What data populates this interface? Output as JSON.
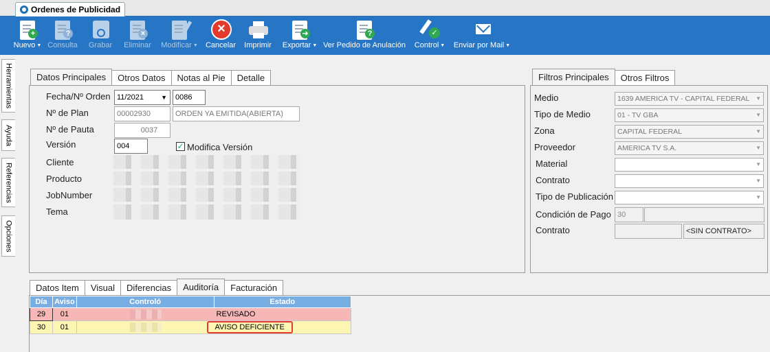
{
  "window": {
    "tab_title": "Ordenes de Publicidad"
  },
  "toolbar": {
    "buttons": [
      {
        "label": "Nuevo",
        "icon": "new-document-icon",
        "enabled": true,
        "dropdown": true
      },
      {
        "label": "Consulta",
        "icon": "query-document-icon",
        "enabled": false,
        "dropdown": false
      },
      {
        "label": "Grabar",
        "icon": "save-disk-icon",
        "enabled": false,
        "dropdown": false
      },
      {
        "label": "Eliminar",
        "icon": "delete-document-icon",
        "enabled": false,
        "dropdown": false
      },
      {
        "label": "Modificar",
        "icon": "edit-document-icon",
        "enabled": false,
        "dropdown": true
      },
      {
        "label": "Cancelar",
        "icon": "cancel-icon",
        "enabled": true,
        "dropdown": false
      },
      {
        "label": "Imprimir",
        "icon": "printer-icon",
        "enabled": true,
        "dropdown": false
      },
      {
        "label": "Exportar",
        "icon": "export-document-icon",
        "enabled": true,
        "dropdown": true
      },
      {
        "label": "Ver Pedido de Anulación",
        "icon": "cancel-request-icon",
        "enabled": true,
        "dropdown": false
      },
      {
        "label": "Control",
        "icon": "approve-pen-icon",
        "enabled": true,
        "dropdown": true
      },
      {
        "label": "Enviar por Mail",
        "icon": "email-icon",
        "enabled": true,
        "dropdown": true
      }
    ]
  },
  "sidebar": {
    "tabs": [
      "Herramientas",
      "Ayuda",
      "Referencias",
      "Opciones"
    ]
  },
  "main_tabs": {
    "items": [
      "Datos Principales",
      "Otros Datos",
      "Notas al Pie",
      "Detalle"
    ],
    "active": "Datos Principales"
  },
  "datos": {
    "fecha_label": "Fecha/Nº Orden",
    "fecha_value": "11/2021",
    "orden_value": "0086",
    "plan_label": "Nº de Plan",
    "plan_value": "00002930",
    "plan_status": "ORDEN YA EMITIDA(ABIERTA)",
    "pauta_label": "Nº de Pauta",
    "pauta_value": "0037",
    "version_label": "Versión",
    "version_value": "004",
    "modifica_label": "Modifica Versión",
    "modifica_checked": true,
    "cliente_label": "Cliente",
    "producto_label": "Producto",
    "jobnumber_label": "JobNumber",
    "tema_label": "Tema"
  },
  "filter_tabs": {
    "items": [
      "Filtros Principales",
      "Otros Filtros"
    ],
    "active": "Filtros Principales"
  },
  "filtros": {
    "medio_label": "Medio",
    "medio_value": "1639 AMERICA TV - CAPITAL FEDERAL",
    "tipo_medio_label": "Tipo de Medio",
    "tipo_medio_value": "01 - TV GBA",
    "zona_label": "Zona",
    "zona_value": "CAPITAL FEDERAL",
    "proveedor_label": "Proveedor",
    "proveedor_value": "AMERICA TV S.A.",
    "material_label": "Material",
    "contrato_label": "Contrato",
    "tipo_pub_label": "Tipo de Publicación",
    "cond_pago_label": "Condición de Pago",
    "cond_pago_value": "30",
    "contrato2_label": "Contrato",
    "contrato2_value": "<SIN CONTRATO>"
  },
  "bottom_tabs": {
    "items": [
      "Datos Item",
      "Visual",
      "Diferencias",
      "Auditoría",
      "Facturación"
    ],
    "active": "Auditoría"
  },
  "audit_table": {
    "columns": [
      "Día",
      "Aviso",
      "Controló",
      "Estado"
    ],
    "rows": [
      {
        "dia": "29",
        "aviso": "01",
        "estado": "REVISADO",
        "color": "#f7b7b7"
      },
      {
        "dia": "30",
        "aviso": "01",
        "estado": "AVISO DEFICIENTE",
        "color": "#fdf6b2"
      }
    ],
    "highlight_color": "#e53935"
  },
  "colors": {
    "toolbar": "#2776c6",
    "header": "#79aee2"
  }
}
